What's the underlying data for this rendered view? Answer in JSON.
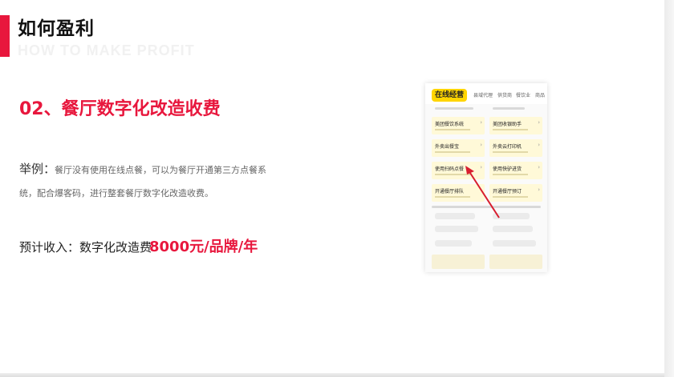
{
  "header": {
    "title": "如何盈利",
    "subtitle": "HOW TO MAKE PROFIT"
  },
  "section": {
    "heading": "02、餐厅数字化改造收费"
  },
  "example": {
    "label": "举例：",
    "line1": "餐厅没有使用在线点餐，可以为餐厅开通第三方点餐系",
    "line2": "统，配合爆客码，进行整套餐厅数字化改造收费。"
  },
  "income": {
    "label": "预计收入：数字化改造费",
    "value": "8000元/品牌/年"
  },
  "phone": {
    "active_tab": "在线经营",
    "tabs": [
      "县域代理",
      "供货商",
      "餐饮业",
      "商品"
    ],
    "cards": [
      "美团餐饮系统",
      "美团收银助手",
      "外卖出餐宝",
      "外卖云打印机",
      "使用扫码点餐",
      "使用快驴进货",
      "开通餐厅排队",
      "开通餐厅预订"
    ]
  },
  "colors": {
    "accent": "#e8173d",
    "highlight": "#ffd500"
  }
}
